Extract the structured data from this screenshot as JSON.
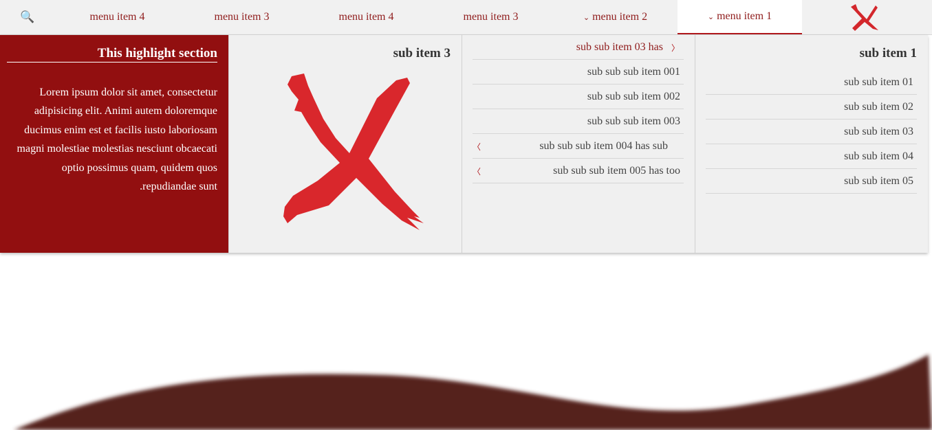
{
  "nav": {
    "search_icon": "magnifier-icon",
    "items": [
      {
        "label": "menu item 4"
      },
      {
        "label": "menu item 3"
      },
      {
        "label": "menu item 4"
      },
      {
        "label": "menu item 3"
      },
      {
        "label": "menu item 2",
        "has_dropdown": true
      },
      {
        "label": "menu item 1",
        "has_dropdown": true,
        "active": true
      }
    ],
    "logo_icon": "red-x-logo-icon"
  },
  "highlight": {
    "title": "This highlight section",
    "body": "Lorem ipsum dolor sit amet, consectetur adipisicing elit. Animi autem doloremque ducimus enim est et facilis iusto laboriosam magni molestiae molestias nesciunt obcaecati optio possimus quam, quidem quos .repudiandae sunt"
  },
  "image_column": {
    "title": "sub item 3"
  },
  "sub_sub_column": {
    "items": [
      {
        "label": "sub sub item 03 has",
        "arrow": "right",
        "highlight": true
      },
      {
        "label": "sub sub sub item 001"
      },
      {
        "label": "sub sub sub item 002"
      },
      {
        "label": "sub sub sub item 003"
      },
      {
        "label": "sub sub sub item 004 has sub",
        "arrow": "left"
      },
      {
        "label": "sub sub sub item 005 has too",
        "arrow": "left"
      }
    ]
  },
  "sub_column": {
    "title": "sub item 1",
    "items": [
      {
        "label": "sub sub item 01"
      },
      {
        "label": "sub sub item 02"
      },
      {
        "label": "sub sub item 03"
      },
      {
        "label": "sub sub item 04"
      },
      {
        "label": "sub sub item 05"
      }
    ]
  },
  "colors": {
    "accent": "#b0191d",
    "highlight_bg": "#920f10",
    "wave": "#55201f"
  }
}
